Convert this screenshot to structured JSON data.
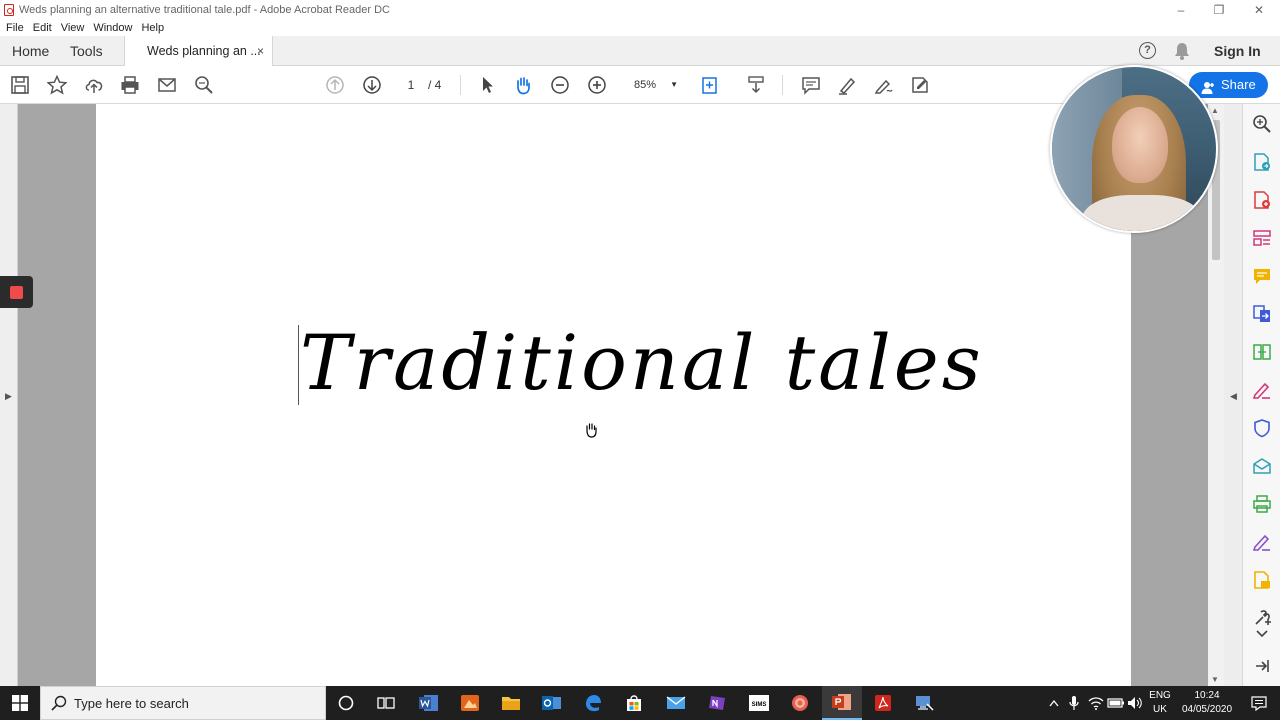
{
  "window": {
    "title": "Weds planning an alternative traditional tale.pdf - Adobe Acrobat Reader DC",
    "minimize_glyph": "–",
    "restore_glyph": "❐",
    "close_glyph": "✕"
  },
  "menu": [
    "File",
    "Edit",
    "View",
    "Window",
    "Help"
  ],
  "tabs": {
    "home": "Home",
    "tools": "Tools",
    "document": "Weds planning an ...",
    "close_glyph": "×",
    "help_glyph": "?",
    "sign_in": "Sign In"
  },
  "toolbar": {
    "current_page": "1",
    "total_pages": "/ 4",
    "zoom": "85%",
    "zoom_caret": "▼",
    "share_label": "Share"
  },
  "document": {
    "heading": "Traditional tales"
  },
  "sidebars": {
    "left_collapse_glyph": "▶",
    "right_collapse_glyph": "◀",
    "scroll_up_glyph": "▲",
    "scroll_down_glyph": "▼"
  },
  "taskbar": {
    "search_placeholder": "Type here to search",
    "language_top": "ENG",
    "language_bottom": "UK",
    "time": "10:24",
    "date": "04/05/2020"
  },
  "colors": {
    "accent": "#1473e6",
    "pdf_red": "#d0261d",
    "record_red": "#f04b4b",
    "taskbar": "#1f1f1f"
  }
}
